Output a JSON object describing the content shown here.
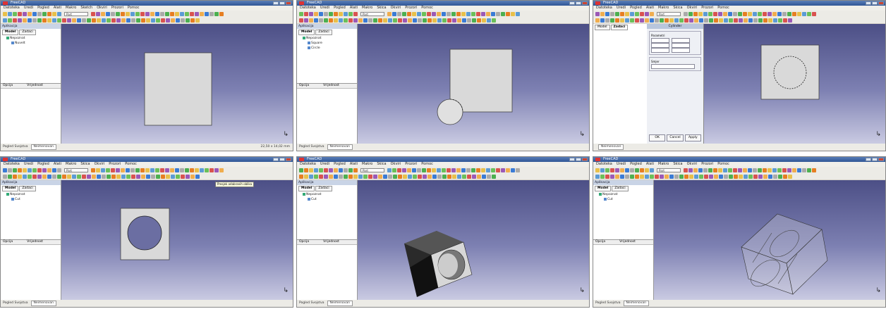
{
  "panels": [
    {
      "title": "FreeCAD",
      "menu": [
        "Datoteka",
        "Uredi",
        "Pogled",
        "Alati",
        "Makro",
        "Sketch",
        "Okviri",
        "Prozori",
        "Pomoc"
      ],
      "workbench": "Part",
      "tabs": [
        "Model",
        "Zadaci"
      ],
      "tree_title": "Aplikacija",
      "tree": [
        "Nepoznat",
        "Nuvelt"
      ],
      "prop_cols": [
        "Opcija",
        "Vrijednost"
      ],
      "doc_tab": "Neimenovan",
      "status_left": "Pogled Svojstva",
      "coords": "22,50 x 14,02 mm"
    },
    {
      "title": "FreeCAD",
      "menu": [
        "Datoteka",
        "Uredi",
        "Pogled",
        "Alati",
        "Makro",
        "Skica",
        "Okviri",
        "Prozori",
        "Pomoc"
      ],
      "workbench": "Part",
      "tabs": [
        "Model",
        "Zadaci"
      ],
      "tree_title": "Aplikacija",
      "tree": [
        "Nepoznat",
        "Square",
        "Circle"
      ],
      "prop_cols": [
        "Opcija",
        "Vrijednost"
      ],
      "doc_tab": "Neimenovan",
      "status_left": "Pogled Svojstva",
      "coords": ""
    },
    {
      "title": "FreeCAD",
      "menu": [
        "Datoteka",
        "Uredi",
        "Pogled",
        "Alati",
        "Makro",
        "Skica",
        "Okviri",
        "Prozori",
        "Pomoc"
      ],
      "workbench": "Part",
      "tabs": [
        "Model",
        "Zadaci"
      ],
      "dialog_title": "Cylinder",
      "dialog_groups": [
        "Parametri",
        "Smjer"
      ],
      "dialog_buttons": [
        "OK",
        "Cancel",
        "Apply"
      ],
      "doc_tab": "Neimenovan",
      "status_left": "",
      "coords": ""
    },
    {
      "title": "FreeCAD",
      "menu": [
        "Datoteka",
        "Uredi",
        "Pogled",
        "Alati",
        "Makro",
        "Skica",
        "Okviri",
        "Prozori",
        "Pomoc"
      ],
      "workbench": "Part",
      "tabs": [
        "Model",
        "Zadaci"
      ],
      "tree_title": "Aplikacija",
      "tree": [
        "Nepoznat",
        "Cut"
      ],
      "prop_cols": [
        "Opcija",
        "Vrijednost"
      ],
      "doc_tab": "Neimenovan",
      "tooltip": "Presjek odabranih oblika",
      "status_left": "Pogled Svojstva",
      "coords": ""
    },
    {
      "title": "FreeCAD",
      "menu": [
        "Datoteka",
        "Uredi",
        "Pogled",
        "Alati",
        "Makro",
        "Skica",
        "Okviri",
        "Prozori",
        "Pomoc"
      ],
      "workbench": "Part",
      "tabs": [
        "Model",
        "Zadaci"
      ],
      "tree_title": "Aplikacija",
      "tree": [
        "Nepoznat",
        "Cut"
      ],
      "prop_cols": [
        "Opcija",
        "Vrijednost"
      ],
      "doc_tab": "Neimenovan",
      "status_left": "Pogled Svojstva",
      "coords": ""
    },
    {
      "title": "FreeCAD",
      "menu": [
        "Datoteka",
        "Uredi",
        "Pogled",
        "Alati",
        "Makro",
        "Skica",
        "Okviri",
        "Prozori",
        "Pomoc"
      ],
      "workbench": "Part",
      "tabs": [
        "Model",
        "Zadaci"
      ],
      "tree_title": "Aplikacija",
      "tree": [
        "Nepoznat",
        "Cut"
      ],
      "prop_cols": [
        "Opcija",
        "Vrijednost"
      ],
      "doc_tab": "Neimenovan",
      "status_left": "Pogled Svojstva",
      "coords": ""
    }
  ],
  "colors": {
    "viewport_top": "#4c4f86",
    "viewport_bottom": "#c9cae2",
    "solid_face": "#d7d7d7"
  },
  "icons": [
    "new-file-icon",
    "open-icon",
    "save-icon",
    "undo-icon",
    "redo-icon",
    "fit-all-icon",
    "box-icon",
    "cylinder-icon",
    "sphere-icon",
    "cone-icon",
    "boolean-cut-icon",
    "macro-record-icon"
  ]
}
